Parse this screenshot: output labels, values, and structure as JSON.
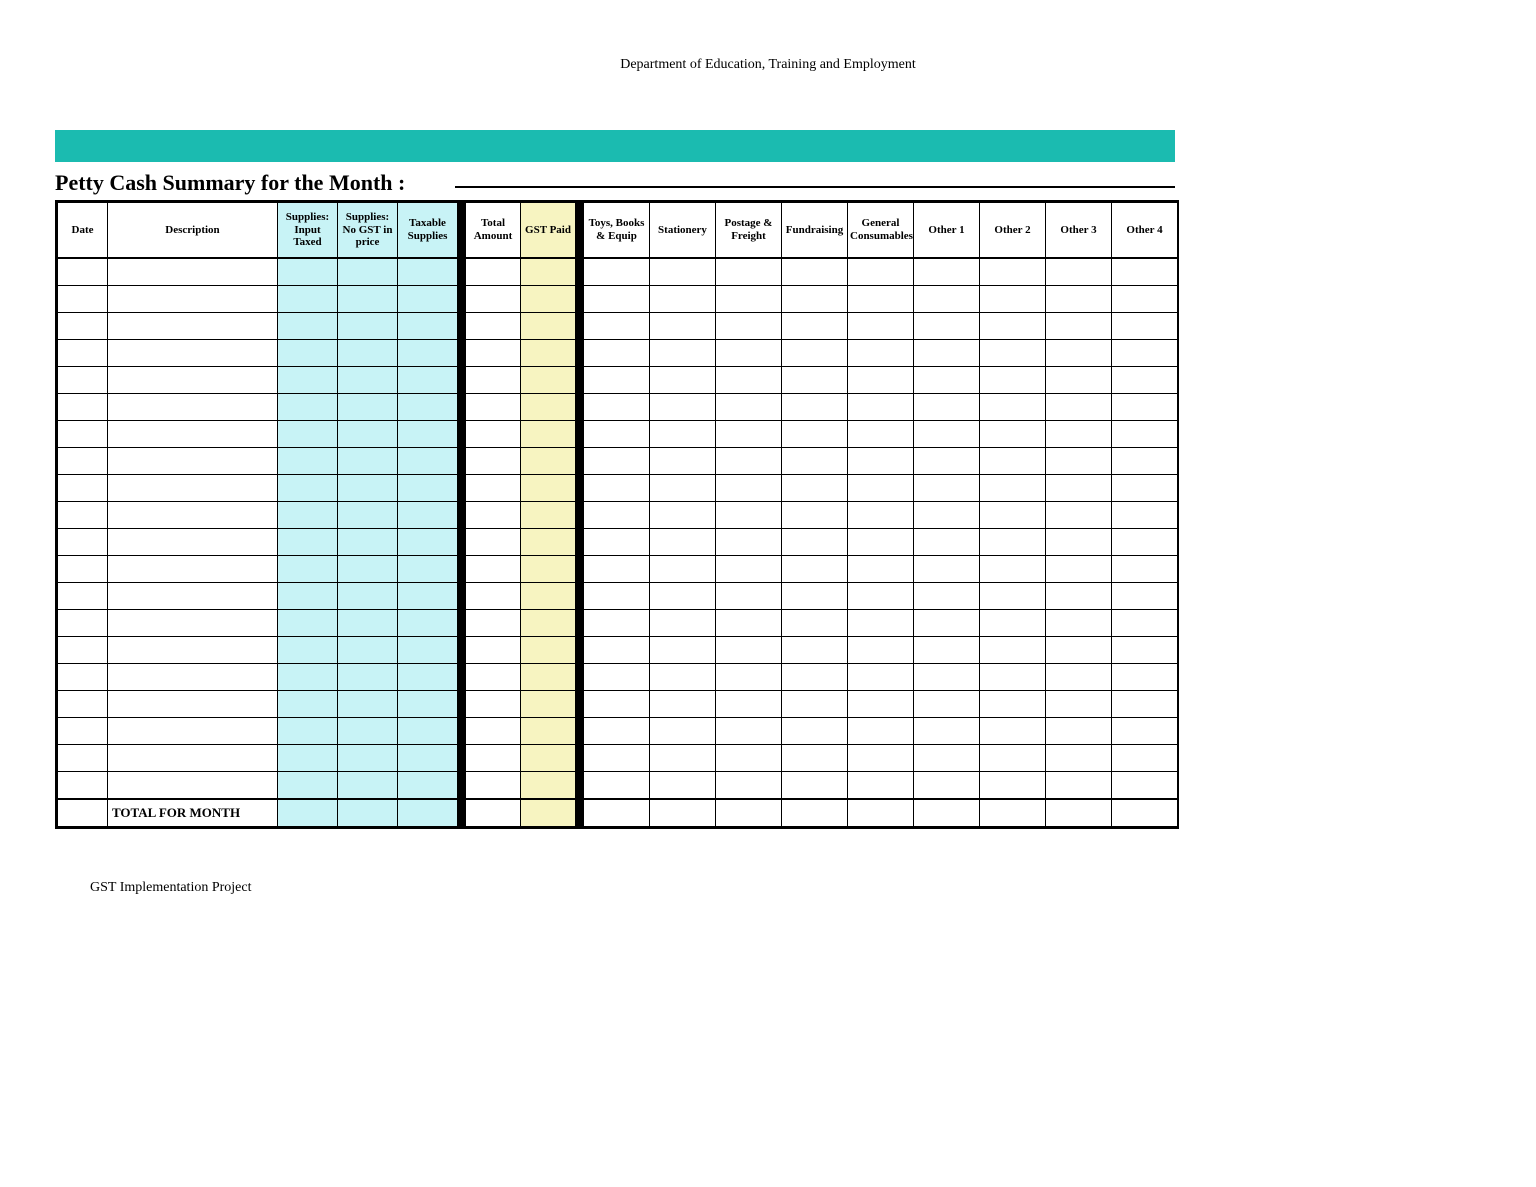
{
  "header": "Department of Education, Training and Employment",
  "title": "Petty Cash Summary for the Month :",
  "columns": [
    "Date",
    "Description",
    "Supplies: Input Taxed",
    "Supplies: No GST in price",
    "Taxable Supplies",
    "Total Amount",
    "GST Paid",
    "Toys, Books & Equip",
    "Stationery",
    "Postage & Freight",
    "Fundraising",
    "General Consumables",
    "Other 1",
    "Other 2",
    "Other 3",
    "Other 4"
  ],
  "data_row_count": 20,
  "total_label": "TOTAL FOR MONTH",
  "footer": "GST Implementation Project"
}
